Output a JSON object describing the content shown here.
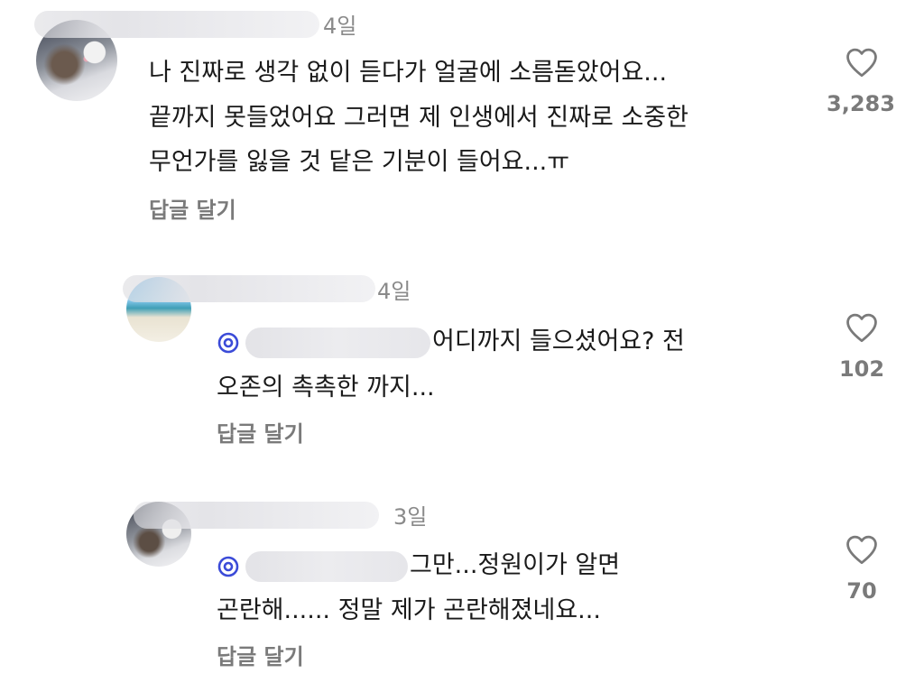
{
  "comments": [
    {
      "time": "4일",
      "lines": [
        "나 진짜로 생각 없이 듣다가 얼굴에 소름돋았어요...",
        "끝까지 못들었어요 그러면 제 인생에서 진짜로 소중한",
        "무언가를 잃을 것 닽은 기분이 들어요...ㅠ"
      ],
      "reply_label": "답글 달기",
      "like_count": "3,283"
    },
    {
      "time": "4일",
      "mention_prefix": "@",
      "line1_after_mention": "어디까지 들으셨어요? 전",
      "line2": "오존의 촉촉한 까지...",
      "reply_label": "답글 달기",
      "like_count": "102"
    },
    {
      "time": "3일",
      "mention_prefix": "@",
      "line1_after_mention": "그만...정원이가 알면",
      "line2": "곤란해...... 정말 제가 곤란해졌네요...",
      "reply_label": "답글 달기",
      "like_count": "70"
    }
  ],
  "icons": {
    "like": "heart-outline-icon",
    "mention": "threads-at-icon"
  },
  "colors": {
    "text": "#1a1a1a",
    "muted": "#7a7a7a",
    "time": "#8a8a8a",
    "mention": "#3b4bd8"
  }
}
